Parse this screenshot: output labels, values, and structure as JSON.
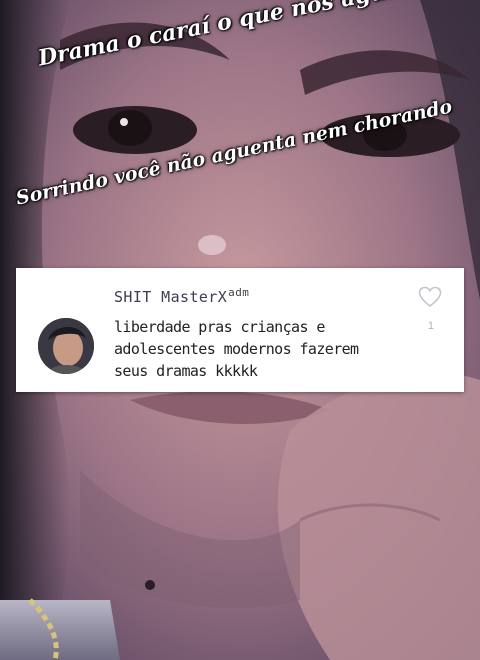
{
  "caption_top": "Drama o caraí o que nos  aguenta",
  "caption_bottom": "Sorrindo você não aguenta nem chorando",
  "comment": {
    "username": "SHIT MasterX",
    "username_suffix": "adm",
    "text": "liberdade pras crianças e adolescentes modernos fazerem seus dramas kkkkk",
    "like_count": "1",
    "like_icon": "heart-outline-icon"
  },
  "colors": {
    "card_background": "#ffffff",
    "username": "#3c3c55",
    "caption": "#ffffff"
  }
}
